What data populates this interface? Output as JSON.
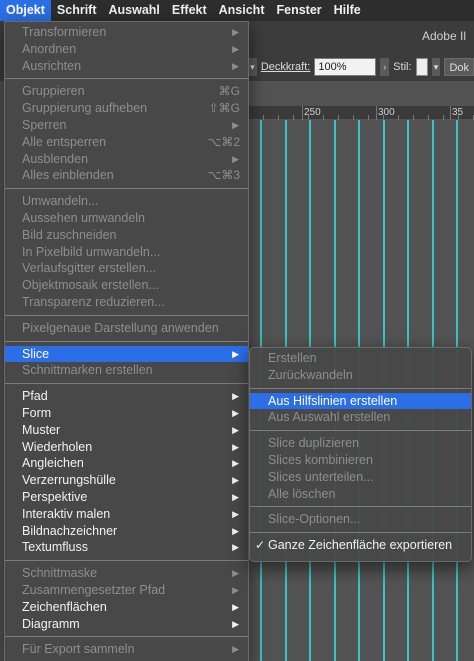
{
  "menubar": {
    "items": [
      {
        "label": "Objekt",
        "active": true
      },
      {
        "label": "Schrift",
        "active": false
      },
      {
        "label": "Auswahl",
        "active": false
      },
      {
        "label": "Effekt",
        "active": false
      },
      {
        "label": "Ansicht",
        "active": false
      },
      {
        "label": "Fenster",
        "active": false
      },
      {
        "label": "Hilfe",
        "active": false
      }
    ]
  },
  "app": {
    "title": "Adobe Il",
    "deckkraft_label": "Deckkraft:",
    "deckkraft_value": "100%",
    "stil_label": "Stil:",
    "dok_label": "Dok"
  },
  "ruler": {
    "labels": [
      "250",
      "300",
      "35"
    ]
  },
  "objekt_menu": {
    "items": [
      {
        "label": "Transformieren",
        "disabled": true,
        "submenu": true
      },
      {
        "label": "Anordnen",
        "disabled": true,
        "submenu": true
      },
      {
        "label": "Ausrichten",
        "disabled": true,
        "submenu": true
      },
      {
        "separator": true
      },
      {
        "label": "Gruppieren",
        "disabled": true,
        "shortcut": "⌘G"
      },
      {
        "label": "Gruppierung aufheben",
        "disabled": true,
        "shortcut": "⇧⌘G"
      },
      {
        "label": "Sperren",
        "disabled": true,
        "submenu": true
      },
      {
        "label": "Alle entsperren",
        "disabled": true,
        "shortcut": "⌥⌘2"
      },
      {
        "label": "Ausblenden",
        "disabled": true,
        "submenu": true
      },
      {
        "label": "Alles einblenden",
        "disabled": true,
        "shortcut": "⌥⌘3"
      },
      {
        "separator": true
      },
      {
        "label": "Umwandeln...",
        "disabled": true
      },
      {
        "label": "Aussehen umwandeln",
        "disabled": true
      },
      {
        "label": "Bild zuschneiden",
        "disabled": true
      },
      {
        "label": "In Pixelbild umwandeln...",
        "disabled": true
      },
      {
        "label": "Verlaufsgitter erstellen...",
        "disabled": true
      },
      {
        "label": "Objektmosaik erstellen...",
        "disabled": true
      },
      {
        "label": "Transparenz reduzieren...",
        "disabled": true
      },
      {
        "separator": true
      },
      {
        "label": "Pixelgenaue Darstellung anwenden",
        "disabled": true
      },
      {
        "separator": true
      },
      {
        "label": "Slice",
        "disabled": false,
        "submenu": true,
        "highlight": true
      },
      {
        "label": "Schnittmarken erstellen",
        "disabled": true
      },
      {
        "separator": true
      },
      {
        "label": "Pfad",
        "disabled": false,
        "submenu": true
      },
      {
        "label": "Form",
        "disabled": false,
        "submenu": true
      },
      {
        "label": "Muster",
        "disabled": false,
        "submenu": true
      },
      {
        "label": "Wiederholen",
        "disabled": false,
        "submenu": true
      },
      {
        "label": "Angleichen",
        "disabled": false,
        "submenu": true
      },
      {
        "label": "Verzerrungshülle",
        "disabled": false,
        "submenu": true
      },
      {
        "label": "Perspektive",
        "disabled": false,
        "submenu": true
      },
      {
        "label": "Interaktiv malen",
        "disabled": false,
        "submenu": true
      },
      {
        "label": "Bildnachzeichner",
        "disabled": false,
        "submenu": true
      },
      {
        "label": "Textumfluss",
        "disabled": false,
        "submenu": true
      },
      {
        "separator": true
      },
      {
        "label": "Schnittmaske",
        "disabled": true,
        "submenu": true
      },
      {
        "label": "Zusammengesetzter Pfad",
        "disabled": true,
        "submenu": true
      },
      {
        "label": "Zeichenflächen",
        "disabled": false,
        "submenu": true
      },
      {
        "label": "Diagramm",
        "disabled": false,
        "submenu": true
      },
      {
        "separator": true
      },
      {
        "label": "Für Export sammeln",
        "disabled": true,
        "submenu": true
      }
    ]
  },
  "slice_menu": {
    "items": [
      {
        "label": "Erstellen",
        "disabled": true
      },
      {
        "label": "Zurückwandeln",
        "disabled": true
      },
      {
        "separator": true
      },
      {
        "label": "Aus Hilfslinien erstellen",
        "disabled": false,
        "highlight": true
      },
      {
        "label": "Aus Auswahl erstellen",
        "disabled": true
      },
      {
        "separator": true
      },
      {
        "label": "Slice duplizieren",
        "disabled": true
      },
      {
        "label": "Slices kombinieren",
        "disabled": true
      },
      {
        "label": "Slices unterteilen...",
        "disabled": true
      },
      {
        "label": "Alle löschen",
        "disabled": true
      },
      {
        "separator": true
      },
      {
        "label": "Slice-Optionen...",
        "disabled": true
      },
      {
        "separator": true
      },
      {
        "label": "Ganze Zeichenfläche exportieren",
        "disabled": false,
        "checked": true
      }
    ]
  },
  "colors": {
    "highlight": "#2a6ee8",
    "guide": "#34c6c8",
    "menubar": "#2d2d2d"
  }
}
